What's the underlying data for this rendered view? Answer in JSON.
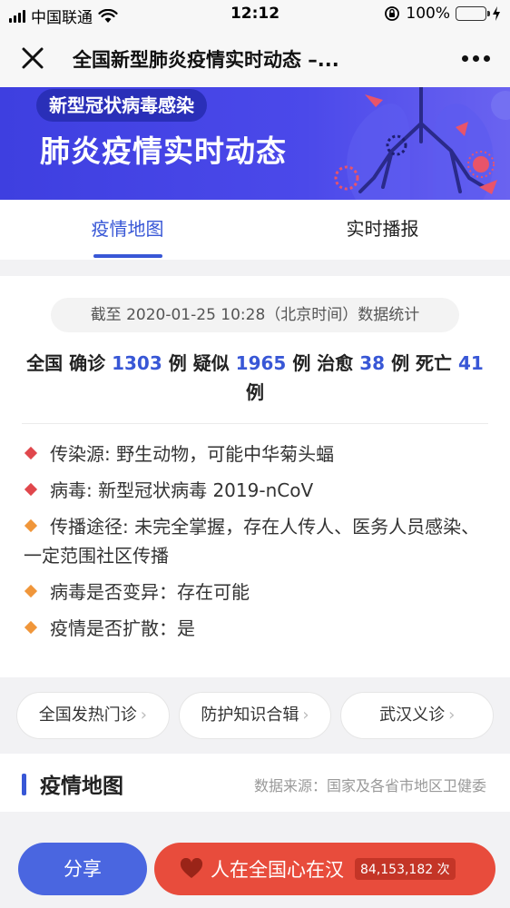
{
  "status_bar": {
    "carrier": "中国联通",
    "time": "12:12",
    "battery_percent": "100%",
    "battery_level": 1.0
  },
  "nav": {
    "title": "全国新型肺炎疫情实时动态 –..."
  },
  "banner": {
    "tag": "新型冠状病毒感染",
    "title": "肺炎疫情实时动态"
  },
  "tabs": [
    {
      "label": "疫情地图",
      "active": true
    },
    {
      "label": "实时播报",
      "active": false
    }
  ],
  "stats": {
    "date_text": "截至 2020-01-25 10:28（北京时间）数据统计",
    "prefix": "全国",
    "confirmed_label": "确诊",
    "confirmed": "1303",
    "suspected_label": "疑似",
    "suspected": "1965",
    "cured_label": "治愈",
    "cured": "38",
    "dead_label": "死亡",
    "dead": "41",
    "unit": "例"
  },
  "facts": [
    {
      "text": "传染源: 野生动物，可能中华菊头蝠",
      "color": "#e0474c"
    },
    {
      "text": "病毒: 新型冠状病毒 2019-nCoV",
      "color": "#e0474c"
    },
    {
      "text": "传播途径: 未完全掌握，存在人传人、医务人员感染、一定范围社区传播",
      "color": "#f0963a"
    },
    {
      "text": "病毒是否变异：存在可能",
      "color": "#f0963a"
    },
    {
      "text": "疫情是否扩散：是",
      "color": "#f0963a"
    }
  ],
  "links": [
    {
      "label": "全国发热门诊"
    },
    {
      "label": "防护知识合辑"
    },
    {
      "label": "武汉义诊"
    }
  ],
  "section": {
    "title": "疫情地图",
    "source": "数据来源：国家及各省市地区卫健委"
  },
  "bottom": {
    "share_label": "分享",
    "cheer_label": "人在全国心在汉",
    "cheer_count": "84,153,182 次"
  },
  "colors": {
    "accent": "#3857d6",
    "banner": "#4b49ea",
    "cheer": "#e84c3c"
  }
}
